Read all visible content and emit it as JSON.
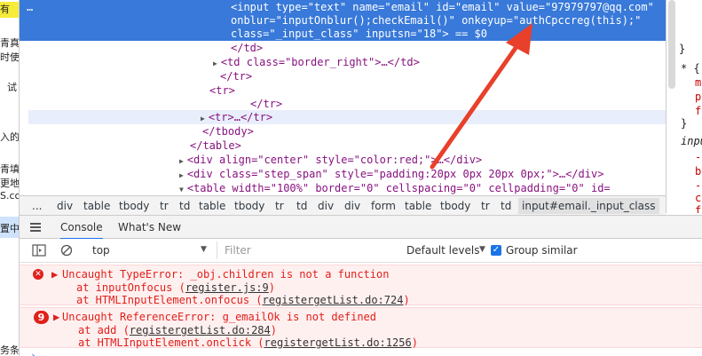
{
  "page_strip": {
    "fragments": [
      "有",
      "青真",
      "时使",
      "试",
      "入的",
      "青填",
      "更地",
      "S.cc",
      "置中",
      "务条"
    ]
  },
  "elements": {
    "expand_dots": "…",
    "selected_lines": [
      "<input type=\"text\" name=\"email\" id=\"email\" value=\"97979797@qq.com\"",
      "onblur=\"inputOnblur();checkEmail()\" onkeyup=\"authCpccreg(this);\"",
      "class=\"_input_class\" inputsn=\"18\"> == $0"
    ],
    "lines": [
      "</td>",
      "<td class=\"border_right\">…</td>",
      "</tr>",
      "<tr>",
      "</tr>",
      "<tr>…</tr>",
      "</tbody>",
      "</table>",
      "<div align=\"center\" style=\"color:red;\">…</div>",
      "<div class=\"step_span\" style=\"padding:20px 0px 20px 0px;\">…</div>",
      "<table width=\"100%\" border=\"0\" cellspacing=\"0\" cellpadding=\"0\" id="
    ]
  },
  "styles_pane": {
    "lines": [
      "}",
      "* {",
      "m",
      "p",
      "f",
      "}",
      "input",
      "-",
      "b",
      "-",
      "c",
      "f"
    ]
  },
  "breadcrumb": [
    "...",
    "div",
    "table",
    "tbody",
    "tr",
    "td",
    "table",
    "tbody",
    "tr",
    "td",
    "div",
    "div",
    "form",
    "table",
    "tbody",
    "tr",
    "td",
    "input#email._input_class"
  ],
  "drawer": {
    "tabs": [
      "Console",
      "What's New"
    ],
    "active_tab": "Console"
  },
  "console_toolbar": {
    "context": "top",
    "filter_placeholder": "Filter",
    "levels": "Default levels",
    "group_similar": "Group similar"
  },
  "messages": [
    {
      "badge": "✕",
      "text": "Uncaught TypeError: _obj.children is not a function",
      "stack": [
        {
          "prefix": "at inputOnfocus (",
          "link": "register.js:9",
          "suffix": ")"
        },
        {
          "prefix": "at HTMLInputElement.onfocus (",
          "link": "registergetList.do:724",
          "suffix": ")"
        }
      ]
    },
    {
      "badge": "9",
      "text": "Uncaught ReferenceError: g_emailOk is not defined",
      "stack": [
        {
          "prefix": "at add (",
          "link": "registergetList.do:284",
          "suffix": ")"
        },
        {
          "prefix": "at HTMLInputElement.onclick (",
          "link": "registergetList.do:1256",
          "suffix": ")"
        }
      ]
    }
  ],
  "prompt": "›",
  "colors": {
    "selection": "#3879d9",
    "error_text": "#e0201a",
    "error_bg": "#fff0f0",
    "annotation_arrow": "#e8402a",
    "accent": "#1a73e8"
  }
}
